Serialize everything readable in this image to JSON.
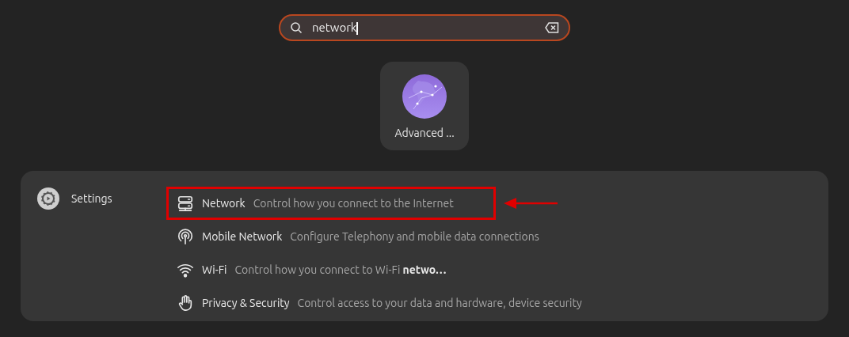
{
  "search": {
    "value": "network"
  },
  "apps": [
    {
      "label": "Advanced ..."
    }
  ],
  "provider": {
    "name": "Settings"
  },
  "results": [
    {
      "kind": "network",
      "title": "Network",
      "description": "Control how you connect to the Internet",
      "highlighted": true
    },
    {
      "kind": "mobile",
      "title": "Mobile Network",
      "description": "Configure Telephony and mobile data connections",
      "highlighted": false
    },
    {
      "kind": "wifi",
      "title": "Wi-Fi",
      "description": "Control how you connect to Wi-Fi **netwo…**",
      "highlighted": false
    },
    {
      "kind": "privacy",
      "title": "Privacy & Security",
      "description": "Control access to your data and hardware, device security",
      "highlighted": false
    }
  ]
}
